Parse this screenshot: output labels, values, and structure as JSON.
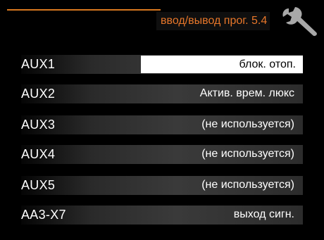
{
  "header": {
    "title": "ввод/вывод прог. 5.4",
    "icon": "wrench-icon",
    "accent_color": "#e8772a"
  },
  "rows": [
    {
      "label": "AUX1",
      "value": "блок. отоп.",
      "selected": true
    },
    {
      "label": "AUX2",
      "value": "Актив. врем. люкс",
      "selected": false
    },
    {
      "label": "AUX3",
      "value": "(не используется)",
      "selected": false
    },
    {
      "label": "AUX4",
      "value": "(не используется)",
      "selected": false
    },
    {
      "label": "AUX5",
      "value": "(не используется)",
      "selected": false
    },
    {
      "label": "AA3-X7",
      "value": "выход сигн.",
      "selected": false
    }
  ]
}
